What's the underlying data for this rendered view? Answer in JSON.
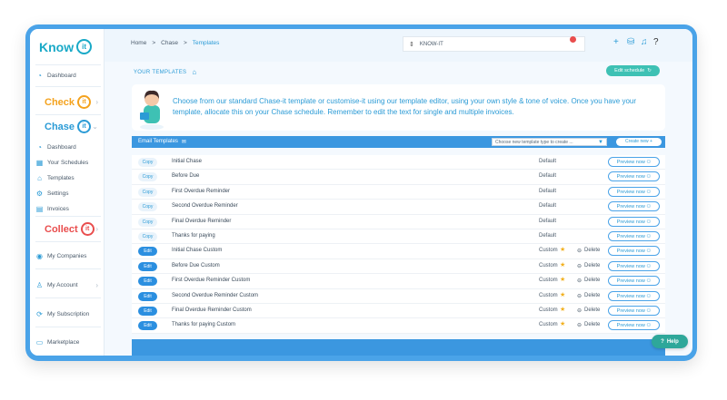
{
  "colors": {
    "frame": "#4aa3e8",
    "accent": "#2b9bd6",
    "teal": "#3ec1b4",
    "star": "#f2b01e",
    "edit": "#2b8fe0"
  },
  "logo": {
    "word": "Know",
    "mark": "it"
  },
  "sidebar": {
    "top_dashboard": "Dashboard",
    "check": {
      "word": "Check",
      "mark": "it",
      "color": "#f4a21d"
    },
    "chase": {
      "word": "Chase",
      "mark": "it",
      "color": "#2b9bd6"
    },
    "chase_items": [
      "Dashboard",
      "Your Schedules",
      "Templates",
      "Settings",
      "Invoices"
    ],
    "collect": {
      "word": "Collect",
      "mark": "it",
      "color": "#e94d4d"
    },
    "bottom_items": [
      "My Companies",
      "My Account",
      "My Subscription",
      "Marketplace"
    ]
  },
  "breadcrumb": {
    "home": "Home",
    "sep": ">",
    "mid": "Chase",
    "current": "Templates"
  },
  "company": {
    "name": "KNOW-IT"
  },
  "section": {
    "title": "YOUR TEMPLATES",
    "edit_schedule": "Edit schedule"
  },
  "banner": {
    "text": "Choose from our standard Chase-it template or customise-it using our template editor, using your own style & tone of voice. Once you have your template, allocate this on your Chase schedule. Remember to edit the text for single and multiple invoices."
  },
  "table": {
    "title": "Email Templates",
    "select_placeholder": "Choose new template type to create ...",
    "create_new": "Create new +",
    "preview_label": "Preview now",
    "delete_label": "Delete",
    "rows": [
      {
        "action": "Copy",
        "name": "Initial Chase",
        "kind": "Default",
        "custom": false
      },
      {
        "action": "Copy",
        "name": "Before Due",
        "kind": "Default",
        "custom": false
      },
      {
        "action": "Copy",
        "name": "First Overdue Reminder",
        "kind": "Default",
        "custom": false
      },
      {
        "action": "Copy",
        "name": "Second Overdue Reminder",
        "kind": "Default",
        "custom": false
      },
      {
        "action": "Copy",
        "name": "Final Overdue Reminder",
        "kind": "Default",
        "custom": false
      },
      {
        "action": "Copy",
        "name": "Thanks for paying",
        "kind": "Default",
        "custom": false
      },
      {
        "action": "Edit",
        "name": "Initial Chase Custom",
        "kind": "Custom",
        "custom": true
      },
      {
        "action": "Edit",
        "name": "Before Due Custom",
        "kind": "Custom",
        "custom": true
      },
      {
        "action": "Edit",
        "name": "First Overdue Reminder Custom",
        "kind": "Custom",
        "custom": true
      },
      {
        "action": "Edit",
        "name": "Second Overdue Reminder Custom",
        "kind": "Custom",
        "custom": true
      },
      {
        "action": "Edit",
        "name": "Final Overdue Reminder Custom",
        "kind": "Custom",
        "custom": true
      },
      {
        "action": "Edit",
        "name": "Thanks for paying Custom",
        "kind": "Custom",
        "custom": true
      }
    ]
  },
  "help": {
    "label": "Help"
  }
}
